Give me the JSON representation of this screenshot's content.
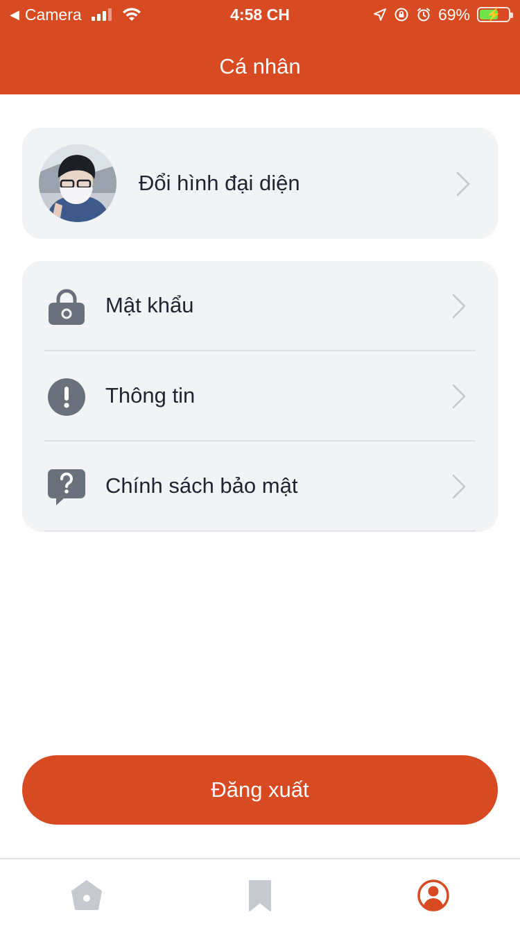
{
  "status_bar": {
    "back_app": "Camera",
    "time": "4:58 CH",
    "battery": "69%",
    "battery_level": 0.69
  },
  "header": {
    "title": "Cá nhân"
  },
  "profile_card": {
    "label": "Đổi hình đại diện"
  },
  "menu": {
    "items": [
      {
        "label": "Mật khẩu",
        "icon": "lock-icon"
      },
      {
        "label": "Thông tin",
        "icon": "info-exclamation-icon"
      },
      {
        "label": "Chính sách bảo mật",
        "icon": "question-chat-icon"
      }
    ]
  },
  "logout": {
    "label": "Đăng xuất"
  },
  "bottom_nav": {
    "items": [
      {
        "icon": "home-icon",
        "active": false
      },
      {
        "icon": "bookmark-icon",
        "active": false
      },
      {
        "icon": "user-profile-icon",
        "active": true
      }
    ]
  },
  "colors": {
    "brand": "#d84a22",
    "card_bg": "#f2f3f5",
    "icon_gray": "#6b707d",
    "nav_inactive": "#c6c9d0"
  }
}
